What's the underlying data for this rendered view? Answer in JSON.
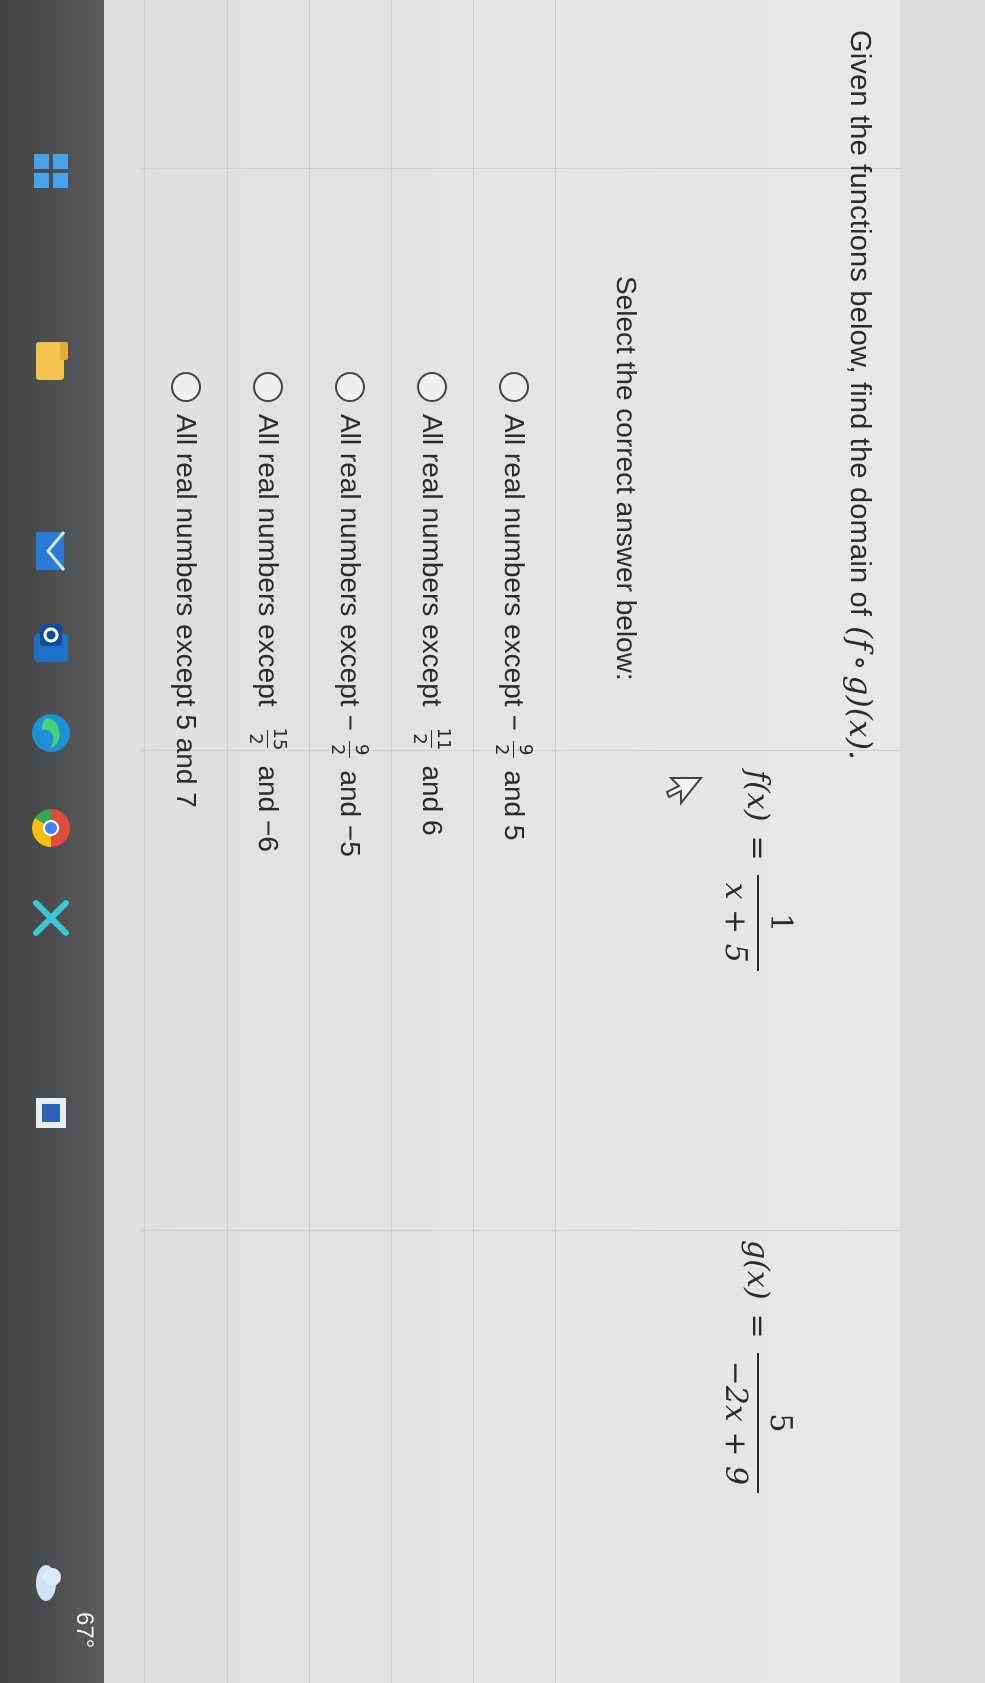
{
  "question": {
    "prompt": "Given the functions below, find the domain of",
    "expression": {
      "open": "(",
      "f": "f",
      "comp": "∘",
      "g": "g",
      "close": ")(x)."
    }
  },
  "functions": {
    "f": {
      "lhs": "f(x)",
      "eq": "=",
      "numerator": "1",
      "denominator": "x + 5"
    },
    "g": {
      "lhs": "g(x)",
      "eq": "=",
      "numerator": "5",
      "denominator": "−2x + 9"
    }
  },
  "select_label": "Select the correct answer below:",
  "options": [
    {
      "pre": "All real numbers except",
      "sign": "−",
      "num": "9",
      "den": "2",
      "post": "and 5"
    },
    {
      "pre": "All real numbers except",
      "sign": "",
      "num": "11",
      "den": "2",
      "post": "and 6"
    },
    {
      "pre": "All real numbers except",
      "sign": "−",
      "num": "9",
      "den": "2",
      "post": "and −5"
    },
    {
      "pre": "All real numbers except",
      "sign": "",
      "num": "15",
      "den": "2",
      "post": "and −6"
    },
    {
      "pre": "All real numbers except 5 and 7",
      "sign": "",
      "num": "",
      "den": "",
      "post": ""
    }
  ],
  "taskbar": {
    "temperature": "67°",
    "icons": [
      "windows-start-icon",
      "file-explorer-icon",
      "mail-icon",
      "outlook-icon",
      "edge-icon",
      "chrome-icon",
      "x-app-icon",
      "app-icon",
      "weather-icon"
    ]
  }
}
